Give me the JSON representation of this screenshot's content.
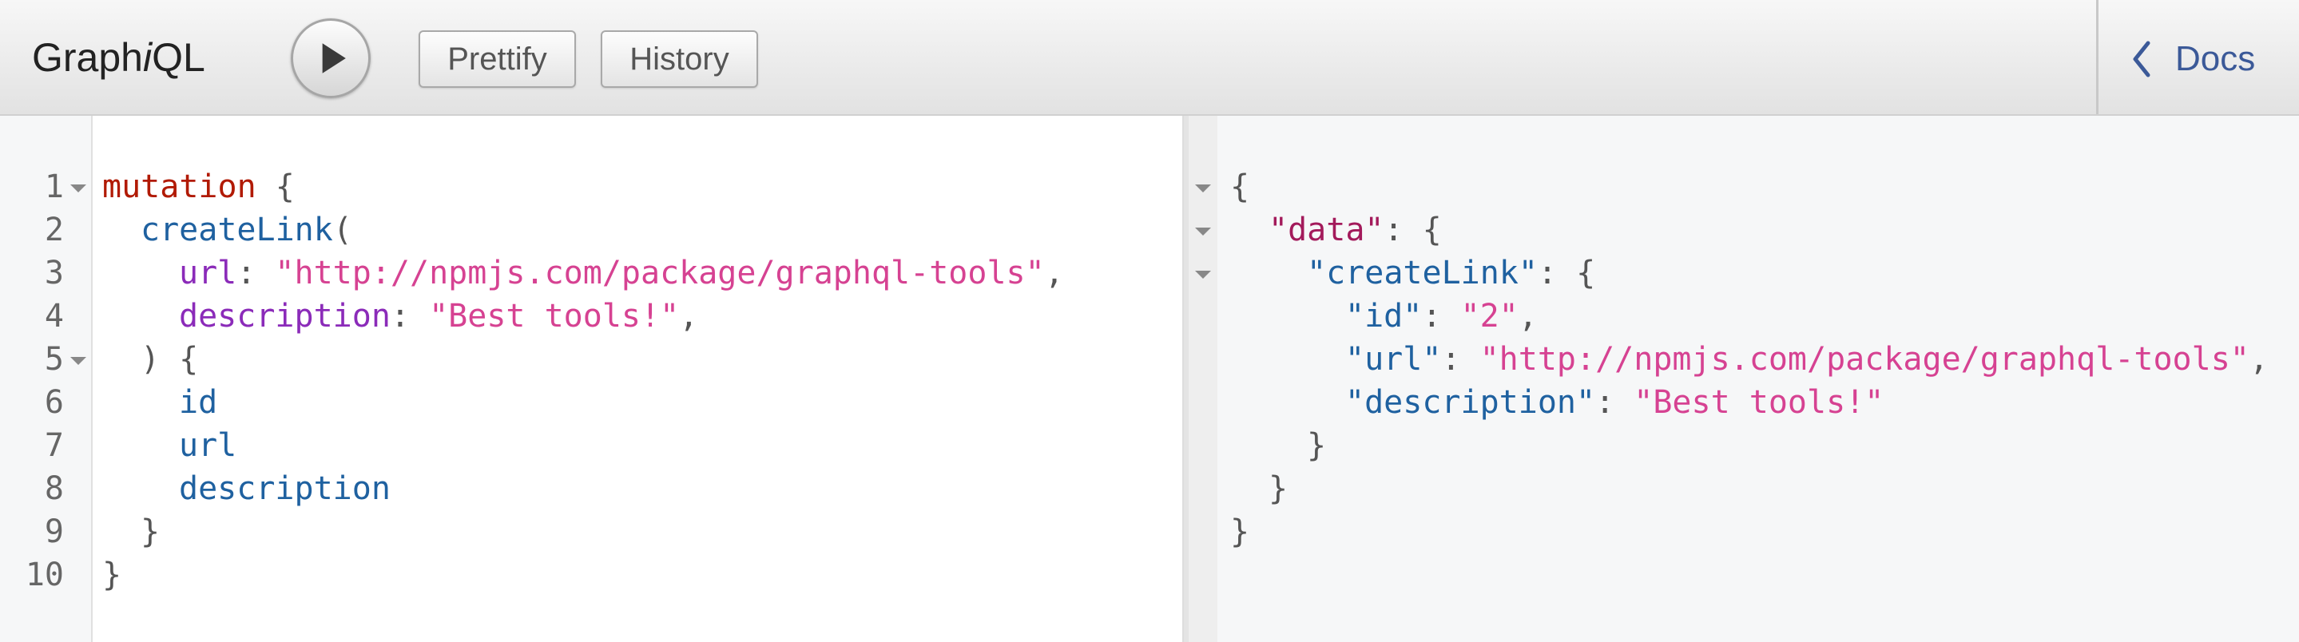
{
  "app": {
    "title_prefix": "Graph",
    "title_italic": "i",
    "title_suffix": "QL"
  },
  "toolbar": {
    "run_icon": "play-icon",
    "prettify_label": "Prettify",
    "history_label": "History",
    "docs_icon": "chevron-left-icon",
    "docs_label": "Docs"
  },
  "colors": {
    "keyword": "#b11a04",
    "field": "#1f61a0",
    "argument": "#8b2bb9",
    "string": "#d64292",
    "punctuation": "#555555",
    "docs_link": "#3b5998"
  },
  "editor": {
    "line_numbers": [
      "1",
      "2",
      "3",
      "4",
      "5",
      "6",
      "7",
      "8",
      "9",
      "10"
    ],
    "folded_lines": [
      "1",
      "5"
    ],
    "lines": [
      {
        "keyword": "mutation",
        "punct": " {"
      },
      {
        "field": "createLink",
        "punct": "("
      },
      {
        "arg": "url",
        "colon": ": ",
        "string": "\"http://npmjs.com/package/graphql-tools\"",
        "punct": ","
      },
      {
        "arg": "description",
        "colon": ": ",
        "string": "\"Best tools!\"",
        "punct": ","
      },
      {
        "punct": ") {"
      },
      {
        "field": "id"
      },
      {
        "field": "url"
      },
      {
        "field": "description"
      },
      {
        "punct": "}"
      },
      {
        "punct": "}"
      }
    ]
  },
  "result": {
    "lines": [
      {
        "punct": "{"
      },
      {
        "key": "\"data\"",
        "punct": ": {"
      },
      {
        "key": "\"createLink\"",
        "punct": ": {"
      },
      {
        "key": "\"id\"",
        "colon": ": ",
        "string": "\"2\"",
        "punct": ","
      },
      {
        "key": "\"url\"",
        "colon": ": ",
        "string": "\"http://npmjs.com/package/graphql-tools\"",
        "punct": ","
      },
      {
        "key": "\"description\"",
        "colon": ": ",
        "string": "\"Best tools!\""
      },
      {
        "punct": "}"
      },
      {
        "punct": "}"
      },
      {
        "punct": "}"
      }
    ]
  }
}
